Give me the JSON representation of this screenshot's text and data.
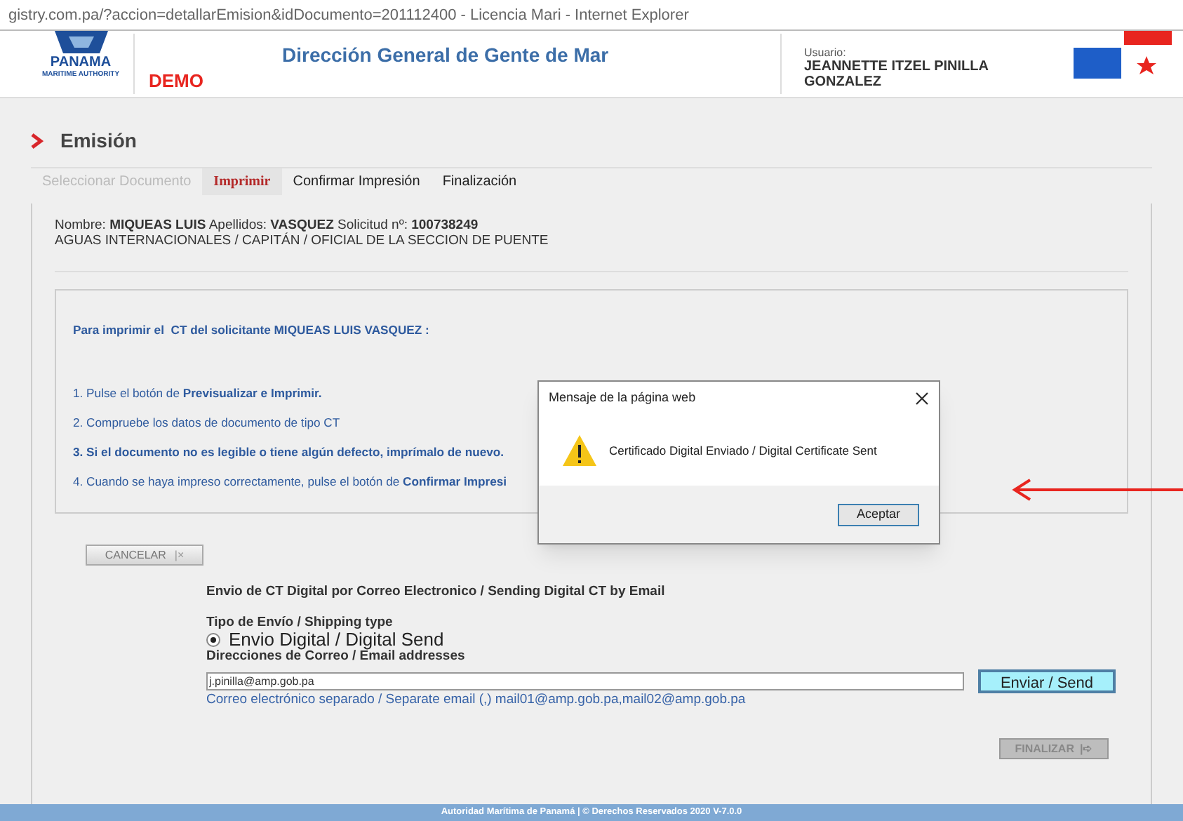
{
  "window": {
    "title": "gistry.com.pa/?accion=detallarEmision&idDocumento=201112400 - Licencia Mari - Internet Explorer"
  },
  "header": {
    "logo_text": "PANAMA",
    "logo_subtext": "MARITIME AUTHORITY",
    "demo": "DEMO",
    "title": "Dirección General de Gente de Mar",
    "user_label": "Usuario:",
    "user_name": "JEANNETTE ITZEL PINILLA GONZALEZ"
  },
  "page_title": "Emisión",
  "tabs": [
    {
      "label": "Seleccionar Documento",
      "selected": false,
      "disabled": true
    },
    {
      "label": "Imprimir",
      "selected": true,
      "disabled": false
    },
    {
      "label": "Confirmar Impresión",
      "selected": false,
      "disabled": false
    },
    {
      "label": "Finalización",
      "selected": false,
      "disabled": false
    }
  ],
  "applicant": {
    "line1": "Nombre: **MIQUEAS LUIS** Apellidos: **VASQUEZ** Solicitud nº: **100738249**",
    "line2": "AGUAS INTERNACIONALES / CAPITÁN / OFICIAL DE LA SECCION DE PUENTE"
  },
  "instructions": {
    "heading": "Para imprimir el  CT del solicitante MIQUEAS LUIS VASQUEZ :",
    "steps": [
      {
        "text": "1. Pulse el botón de **Previsualizar e Imprimir.**",
        "emphasis": false
      },
      {
        "text": "2. Compruebe los datos de documento de tipo CT",
        "emphasis": false
      },
      {
        "text": "3. Si el documento no es legible o tiene algún defecto, imprímalo de nuevo.",
        "emphasis": true
      },
      {
        "text": "4. Cuando se haya impreso correctamente, pulse el botón de **Confirmar Impresi**",
        "emphasis": false
      }
    ]
  },
  "cancel_button": {
    "label": "CANCELAR",
    "separator": "|",
    "icon": "×"
  },
  "email_section": {
    "title": "Envio de CT Digital por Correo Electronico / Sending Digital CT by Email",
    "shipping_label": "Tipo de Envío / Shipping type",
    "options": [
      {
        "label": "Envio Digital / Digital Send",
        "selected": true
      }
    ],
    "address_label": "Direcciones de Correo / Email addresses",
    "address_value": "j.pinilla@amp.gob.pa",
    "hint": "Correo electrónico separado / Separate email (,) mail01@amp.gob.pa,mail02@amp.gob.pa",
    "send_button": "Enviar / Send"
  },
  "finish_button": {
    "label": "FINALIZAR",
    "separator": "|",
    "icon": "➪",
    "disabled": true
  },
  "footer": "Autoridad Marítima de Panamá | © Derechos Reservados 2020 V-7.0.0",
  "dialog": {
    "title": "Mensaje de la página web",
    "message": "Certificado Digital Enviado / Digital Certificate Sent",
    "button": "Aceptar"
  }
}
